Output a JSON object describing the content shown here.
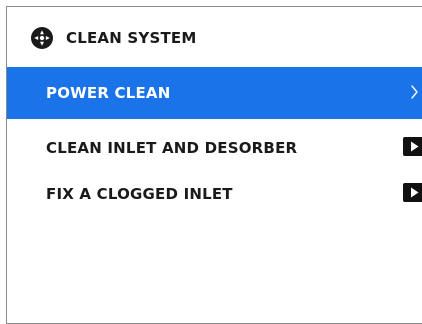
{
  "header": {
    "title": "CLEAN SYSTEM",
    "icon": "system-gear-icon"
  },
  "menu": {
    "items": [
      {
        "label": "POWER CLEAN",
        "selected": true,
        "icon": "chevron-right-icon"
      },
      {
        "label": "CLEAN INLET AND DESORBER",
        "selected": false,
        "icon": "play-video-icon"
      },
      {
        "label": "FIX A CLOGGED INLET",
        "selected": false,
        "icon": "play-video-icon"
      }
    ]
  },
  "colors": {
    "selected_bg": "#1a73e8",
    "text": "#1a1a1a",
    "border": "#8a8a8a"
  }
}
